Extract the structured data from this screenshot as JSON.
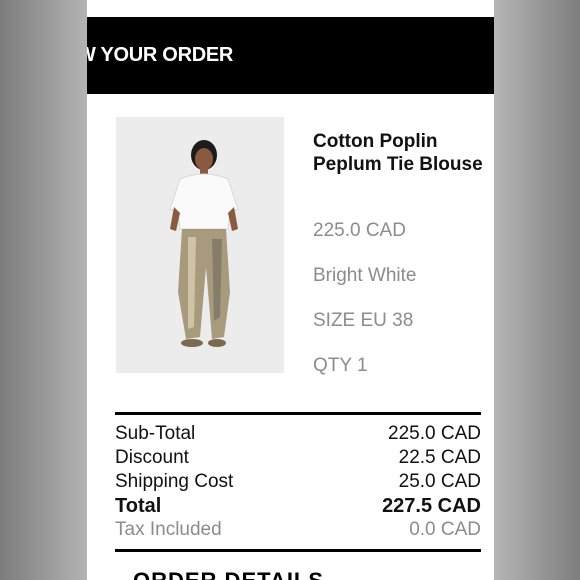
{
  "header": {
    "title": "W YOUR ORDER"
  },
  "product": {
    "name": "Cotton Poplin Peplum Tie Blouse",
    "price": "225.0 CAD",
    "color": "Bright White",
    "size": "SIZE EU 38",
    "qty": "QTY 1"
  },
  "summary": {
    "rows": [
      {
        "label": "Sub-Total",
        "value": "225.0 CAD"
      },
      {
        "label": "Discount",
        "value": "22.5 CAD"
      },
      {
        "label": "Shipping Cost",
        "value": "25.0 CAD"
      },
      {
        "label": "Total",
        "value": "227.5 CAD"
      },
      {
        "label": "Tax Included",
        "value": "0.0 CAD"
      }
    ]
  },
  "next_section": {
    "title": "ORDER DETAILS"
  },
  "colors": {
    "header_bg": "#000000",
    "muted_text": "#8c8c8c",
    "primary_text": "#111111",
    "image_bg": "#ebebeb"
  }
}
